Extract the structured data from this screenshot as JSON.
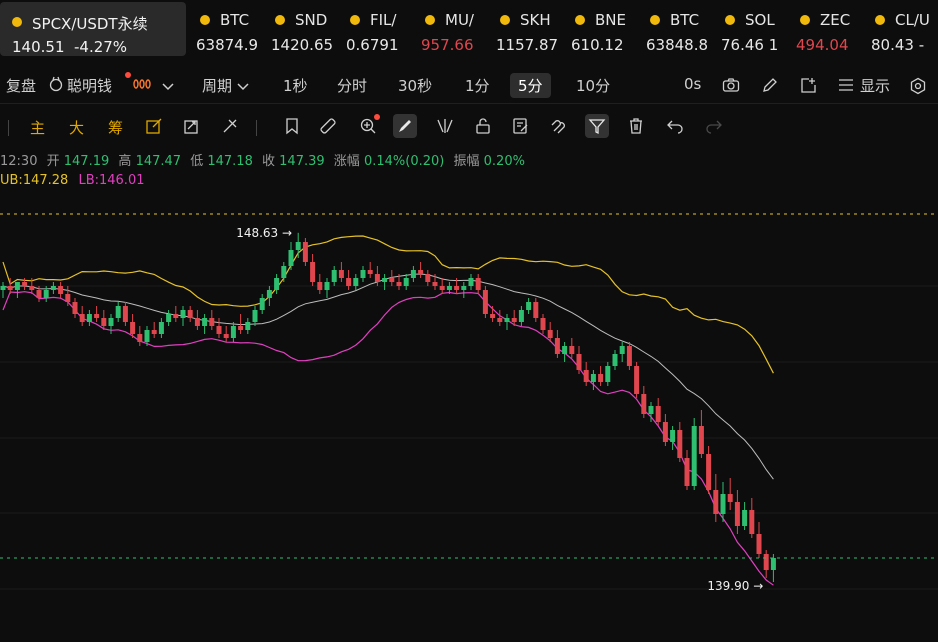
{
  "active_ticker": {
    "symbol": "SPCX/USDT永续",
    "price": "140.51",
    "change": "-4.27%"
  },
  "tickers": [
    {
      "symbol": "BTC",
      "price": "63874.9",
      "dir": "up"
    },
    {
      "symbol": "SND",
      "price": "1420.65",
      "dir": "up"
    },
    {
      "symbol": "FIL/",
      "price": "0.6791",
      "dir": "up"
    },
    {
      "symbol": "MU/",
      "price": "957.66",
      "dir": "down"
    },
    {
      "symbol": "SKH",
      "price": "1157.87",
      "dir": "up"
    },
    {
      "symbol": "BNE",
      "price": "610.12",
      "dir": "up"
    },
    {
      "symbol": "BTC",
      "price": "63848.8",
      "dir": "up"
    },
    {
      "symbol": "SOL",
      "price": "76.46 1",
      "dir": "up"
    },
    {
      "symbol": "ZEC",
      "price": "494.04",
      "dir": "down"
    },
    {
      "symbol": "CL/U",
      "price": "80.43 -",
      "dir": "up"
    }
  ],
  "period_bar": {
    "replay": "复盘",
    "smart_money": "聪明钱",
    "period": "周期",
    "intervals": [
      "1秒",
      "分时",
      "30秒",
      "1分",
      "5分",
      "10分"
    ],
    "active_interval": "5分",
    "countdown": "0s",
    "display": "显示"
  },
  "indicator_tabs": [
    "主",
    "大",
    "筹"
  ],
  "ohlc": {
    "time": "12:30",
    "open_label": "开",
    "open": "147.19",
    "high_label": "高",
    "high": "147.47",
    "low_label": "低",
    "low": "147.18",
    "close_label": "收",
    "close": "147.39",
    "change_label": "涨幅",
    "change": "0.14%(0.20)",
    "amp_label": "振幅",
    "amp": "0.20%"
  },
  "boll": {
    "ub": "UB:147.28",
    "lb": "LB:146.01"
  },
  "chart_data": {
    "type": "candlestick",
    "interval": "5m",
    "high_marker": "148.63",
    "low_marker": "139.90",
    "candles": [
      [
        147.2,
        147.4,
        147.0,
        147.3
      ],
      [
        147.3,
        147.5,
        147.1,
        147.2
      ],
      [
        147.2,
        147.4,
        147.0,
        147.4
      ],
      [
        147.4,
        147.5,
        147.2,
        147.3
      ],
      [
        147.3,
        147.5,
        147.1,
        147.2
      ],
      [
        147.2,
        147.3,
        146.9,
        147.0
      ],
      [
        147.0,
        147.3,
        146.9,
        147.2
      ],
      [
        147.2,
        147.4,
        147.1,
        147.3
      ],
      [
        147.3,
        147.4,
        147.0,
        147.1
      ],
      [
        147.1,
        147.3,
        146.8,
        146.9
      ],
      [
        146.9,
        147.0,
        146.5,
        146.6
      ],
      [
        146.6,
        146.8,
        146.3,
        146.4
      ],
      [
        146.4,
        146.7,
        146.3,
        146.6
      ],
      [
        146.6,
        146.8,
        146.4,
        146.5
      ],
      [
        146.5,
        146.7,
        146.2,
        146.3
      ],
      [
        146.3,
        146.6,
        146.1,
        146.5
      ],
      [
        146.5,
        146.9,
        146.4,
        146.8
      ],
      [
        146.8,
        146.9,
        146.3,
        146.4
      ],
      [
        146.4,
        146.6,
        146.0,
        146.1
      ],
      [
        146.1,
        146.3,
        145.8,
        145.9
      ],
      [
        145.9,
        146.3,
        145.8,
        146.2
      ],
      [
        146.2,
        146.4,
        146.0,
        146.1
      ],
      [
        146.1,
        146.5,
        146.0,
        146.4
      ],
      [
        146.4,
        146.7,
        146.3,
        146.6
      ],
      [
        146.6,
        146.8,
        146.4,
        146.5
      ],
      [
        146.5,
        146.8,
        146.3,
        146.7
      ],
      [
        146.7,
        146.8,
        146.4,
        146.5
      ],
      [
        146.5,
        146.7,
        146.2,
        146.3
      ],
      [
        146.3,
        146.6,
        146.1,
        146.5
      ],
      [
        146.5,
        146.7,
        146.2,
        146.3
      ],
      [
        146.3,
        146.5,
        146.0,
        146.1
      ],
      [
        146.1,
        146.3,
        145.9,
        146.0
      ],
      [
        146.0,
        146.4,
        145.9,
        146.3
      ],
      [
        146.3,
        146.6,
        146.1,
        146.2
      ],
      [
        146.2,
        146.5,
        146.1,
        146.4
      ],
      [
        146.4,
        146.8,
        146.3,
        146.7
      ],
      [
        146.7,
        147.1,
        146.6,
        147.0
      ],
      [
        147.0,
        147.3,
        146.8,
        147.2
      ],
      [
        147.2,
        147.6,
        147.1,
        147.5
      ],
      [
        147.5,
        147.9,
        147.4,
        147.8
      ],
      [
        147.8,
        148.4,
        147.7,
        148.2
      ],
      [
        148.2,
        148.63,
        148.0,
        148.4
      ],
      [
        148.4,
        148.5,
        147.8,
        147.9
      ],
      [
        147.9,
        148.1,
        147.3,
        147.4
      ],
      [
        147.4,
        147.6,
        147.1,
        147.2
      ],
      [
        147.2,
        147.5,
        147.0,
        147.4
      ],
      [
        147.4,
        147.8,
        147.3,
        147.7
      ],
      [
        147.7,
        147.9,
        147.4,
        147.5
      ],
      [
        147.5,
        147.7,
        147.2,
        147.3
      ],
      [
        147.3,
        147.6,
        147.2,
        147.5
      ],
      [
        147.5,
        147.8,
        147.4,
        147.7
      ],
      [
        147.7,
        147.9,
        147.5,
        147.6
      ],
      [
        147.6,
        147.8,
        147.3,
        147.4
      ],
      [
        147.4,
        147.6,
        147.2,
        147.5
      ],
      [
        147.5,
        147.7,
        147.3,
        147.4
      ],
      [
        147.4,
        147.6,
        147.2,
        147.3
      ],
      [
        147.3,
        147.6,
        147.2,
        147.5
      ],
      [
        147.5,
        147.8,
        147.4,
        147.7
      ],
      [
        147.7,
        147.9,
        147.5,
        147.6
      ],
      [
        147.6,
        147.7,
        147.3,
        147.4
      ],
      [
        147.4,
        147.6,
        147.2,
        147.3
      ],
      [
        147.3,
        147.5,
        147.1,
        147.2
      ],
      [
        147.2,
        147.4,
        147.1,
        147.3
      ],
      [
        147.3,
        147.5,
        147.1,
        147.2
      ],
      [
        147.2,
        147.4,
        147.0,
        147.3
      ],
      [
        147.3,
        147.6,
        147.2,
        147.5
      ],
      [
        147.5,
        147.6,
        147.1,
        147.2
      ],
      [
        147.2,
        147.3,
        146.5,
        146.6
      ],
      [
        146.6,
        146.8,
        146.4,
        146.5
      ],
      [
        146.5,
        146.7,
        146.3,
        146.4
      ],
      [
        146.4,
        146.6,
        146.2,
        146.5
      ],
      [
        146.5,
        146.7,
        146.3,
        146.4
      ],
      [
        146.4,
        146.8,
        146.3,
        146.7
      ],
      [
        146.7,
        147.0,
        146.6,
        146.9
      ],
      [
        146.9,
        147.0,
        146.4,
        146.5
      ],
      [
        146.5,
        146.6,
        146.1,
        146.2
      ],
      [
        146.2,
        146.4,
        145.9,
        146.0
      ],
      [
        146.0,
        146.2,
        145.5,
        145.6
      ],
      [
        145.6,
        145.9,
        145.4,
        145.8
      ],
      [
        145.8,
        146.0,
        145.5,
        145.6
      ],
      [
        145.6,
        145.8,
        145.1,
        145.2
      ],
      [
        145.2,
        145.4,
        144.8,
        144.9
      ],
      [
        144.9,
        145.2,
        144.7,
        145.1
      ],
      [
        145.1,
        145.3,
        144.8,
        144.9
      ],
      [
        144.9,
        145.4,
        144.8,
        145.3
      ],
      [
        145.3,
        145.7,
        145.2,
        145.6
      ],
      [
        145.6,
        145.9,
        145.4,
        145.8
      ],
      [
        145.8,
        145.9,
        145.2,
        145.3
      ],
      [
        145.3,
        145.4,
        144.5,
        144.6
      ],
      [
        144.6,
        144.8,
        144.0,
        144.1
      ],
      [
        144.1,
        144.4,
        143.9,
        144.3
      ],
      [
        144.3,
        144.5,
        143.8,
        143.9
      ],
      [
        143.9,
        144.1,
        143.3,
        143.4
      ],
      [
        143.4,
        143.8,
        143.2,
        143.7
      ],
      [
        143.7,
        143.9,
        142.9,
        143.0
      ],
      [
        143.0,
        143.2,
        142.2,
        142.3
      ],
      [
        142.3,
        144.0,
        142.2,
        143.8
      ],
      [
        143.8,
        144.2,
        143.0,
        143.1
      ],
      [
        143.1,
        143.3,
        142.1,
        142.2
      ],
      [
        142.2,
        142.6,
        141.4,
        141.6
      ],
      [
        141.6,
        142.4,
        141.4,
        142.1
      ],
      [
        142.1,
        142.5,
        141.7,
        141.9
      ],
      [
        141.9,
        142.2,
        141.1,
        141.3
      ],
      [
        141.3,
        141.9,
        141.2,
        141.7
      ],
      [
        141.7,
        142.0,
        141.0,
        141.1
      ],
      [
        141.1,
        141.4,
        140.5,
        140.6
      ],
      [
        140.6,
        140.7,
        140.0,
        140.2
      ],
      [
        140.2,
        140.6,
        139.9,
        140.5
      ]
    ]
  }
}
